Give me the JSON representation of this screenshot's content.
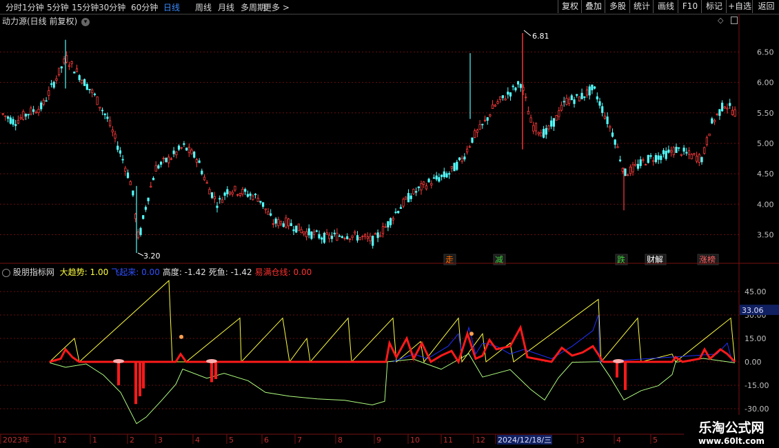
{
  "toolbar": {
    "periods": [
      "分时",
      "1分钟",
      "5分钟",
      "15分钟",
      "30分钟",
      "60分钟",
      "日线",
      "周线",
      "月线",
      "多周期",
      "更多"
    ],
    "active_period": "日线",
    "buttons": [
      "复权",
      "叠加",
      "多股",
      "统计",
      "画线",
      "F10",
      "标记",
      "+自选",
      "返回"
    ]
  },
  "main_panel": {
    "title": "动力源(日线 前复权)",
    "price_axis_labels": [
      "6.50",
      "6.00",
      "5.50",
      "5.00",
      "4.50",
      "4.00",
      "3.50"
    ],
    "high_marker": "6.81",
    "low_marker": "3.20",
    "signal_tags": [
      {
        "text": "走",
        "color": "#ff6a00"
      },
      {
        "text": "减",
        "color": "#40d040"
      },
      {
        "text": "跌",
        "color": "#40d040"
      },
      {
        "text": "财解",
        "color": "#ffffff"
      },
      {
        "text": "涨榜",
        "color": "#ff6060"
      }
    ],
    "colors": {
      "up": "#ff3d3d",
      "down": "#54ffff"
    }
  },
  "indicator_panel": {
    "name": "股朋指标网",
    "fields": [
      {
        "label": "大趋势:",
        "value": "1.00",
        "color": "#ffff40"
      },
      {
        "label": "飞起来:",
        "value": "0.00",
        "color": "#3050ff"
      },
      {
        "label": "高度:",
        "value": "-1.42",
        "color": "#e0e0e0"
      },
      {
        "label": "死鱼:",
        "value": "-1.42",
        "color": "#e0e0e0"
      },
      {
        "label": "易满仓线:",
        "value": "0.00",
        "color": "#ff3030"
      }
    ],
    "axis_labels": [
      "45.00",
      "30.00",
      "15.00",
      "0.00",
      "-15.00",
      "-30.00"
    ],
    "current_value_tag": "33.06"
  },
  "date_axis": {
    "labels": [
      "2023年",
      "12",
      "1",
      "2",
      "3",
      "4",
      "5",
      "6",
      "7",
      "8",
      "9",
      "10",
      "11",
      "12",
      "2024/12/18/三",
      "3",
      "4",
      "5"
    ]
  },
  "watermark": {
    "title": "乐淘公式网",
    "url": "www.60lt.com"
  }
}
